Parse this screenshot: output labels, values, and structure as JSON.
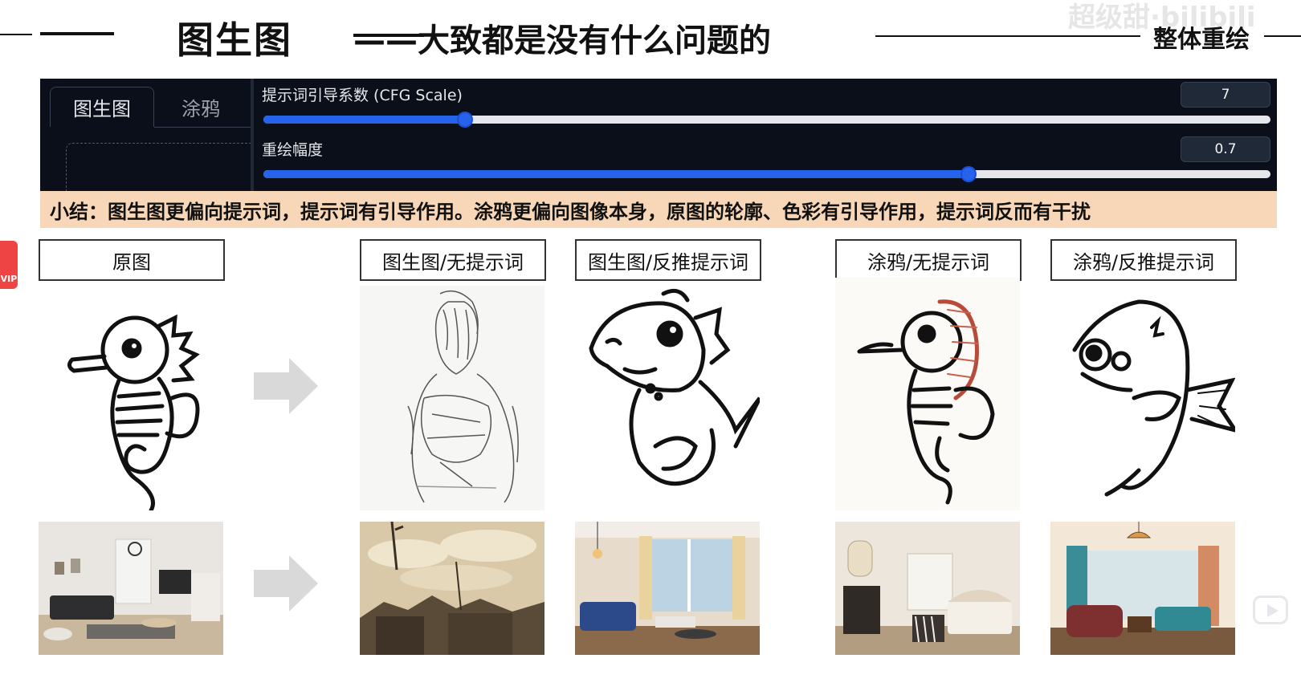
{
  "header": {
    "title": "图生图",
    "subtitle": "——大致都是没有什么问题的",
    "right_label": "整体重绘",
    "watermark": "超级甜·bilibili"
  },
  "ui_panel": {
    "tabs": [
      {
        "label": "图生图",
        "active": true
      },
      {
        "label": "涂鸦",
        "active": false
      }
    ],
    "sliders": [
      {
        "label": "提示词引导系数 (CFG Scale)",
        "value": "7",
        "fill_fraction": 0.2
      },
      {
        "label": "重绘幅度",
        "value": "0.7",
        "fill_fraction": 0.7
      }
    ],
    "accent_color": "#2563eb"
  },
  "summary": "小结：图生图更偏向提示词，提示词有引导作用。涂鸦更偏向图像本身，原图的轮廓、色彩有引导作用，提示词反而有干扰",
  "columns": [
    {
      "label": "原图"
    },
    {
      "label": "图生图/无提示词"
    },
    {
      "label": "图生图/反推提示词"
    },
    {
      "label": "涂鸦/无提示词"
    },
    {
      "label": "涂鸦/反推提示词"
    }
  ],
  "side_badge": "VIP",
  "icons": [
    "arrow-right-icon",
    "play-icon"
  ]
}
